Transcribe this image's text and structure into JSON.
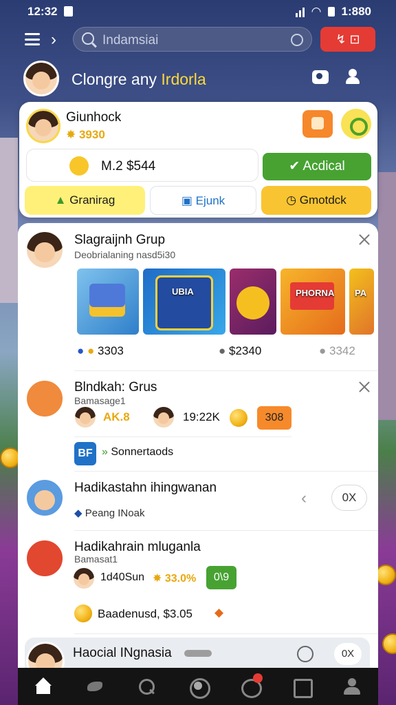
{
  "status": {
    "time": "12:32",
    "battery": "1:880"
  },
  "search": {
    "placeholder": "Indamsiai"
  },
  "top_button": {
    "label": "↯ ⊡"
  },
  "profile": {
    "greeting": "Clongre any",
    "highlight": "Irdorla"
  },
  "wallet": {
    "name": "Giunhock",
    "points": "3930",
    "balance": "M.2 $544",
    "accept_label": "Acdical",
    "actions": [
      {
        "label": "Granirag"
      },
      {
        "label": "Ejunk"
      },
      {
        "label": "Gmotdck"
      }
    ]
  },
  "feed": {
    "item1": {
      "title": "Slagraijnh Grup",
      "subtitle": "Deobrialaning nasd5i30",
      "thumb_labels": [
        "",
        "UBIA",
        "",
        "PHORNA",
        "PA"
      ],
      "stats": [
        "3303",
        "$2340",
        "3342"
      ]
    },
    "item2": {
      "title": "Blndkah: Grus",
      "subtitle": "Bamasage1",
      "tag1": "AK.8",
      "amount": "19:22K",
      "pill": "308",
      "badge": "BF",
      "badge_label": "Sonnertaods"
    },
    "item3": {
      "title": "Hadikastahn ihingwanan",
      "subtitle": "Peang INoak",
      "button": "0X"
    },
    "item4": {
      "title": "Hadikahrain mluganla",
      "subtitle": "Bamasat1",
      "detail": "1d40Sun",
      "percent": "33.0%",
      "pill": "0\\9",
      "footer": "Baadenusd, $3.05"
    },
    "item5": {
      "title": "Haocial INgnasia",
      "button": "0X"
    }
  }
}
